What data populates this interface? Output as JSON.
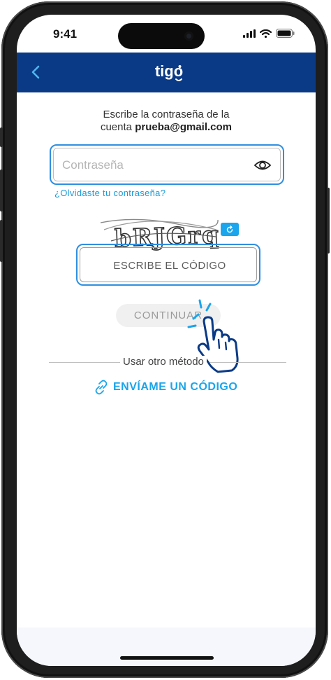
{
  "status_bar": {
    "time": "9:41"
  },
  "header": {
    "brand": "tigo"
  },
  "prompt": {
    "line1": "Escribe la contraseña de la",
    "line2_prefix": "cuenta ",
    "email": "prueba@gmail.com"
  },
  "password": {
    "placeholder": "Contraseña",
    "value": ""
  },
  "forgot_link": "¿Olvidaste tu contraseña?",
  "captcha": {
    "text": "bRJGrq"
  },
  "code_input": {
    "placeholder": "ESCRIBE EL CÓDIGO",
    "value": ""
  },
  "continue_button": "CONTINUAR",
  "alt_method": {
    "label": "Usar otro método",
    "send_code_label": "ENVÍAME UN CÓDIGO"
  },
  "colors": {
    "header_bg": "#0a3a86",
    "accent": "#1aa5ec",
    "focus_border": "#2f8fe0",
    "hand_outline": "#0a3a86"
  },
  "icons": [
    "back-arrow-icon",
    "eye-icon",
    "refresh-icon",
    "link-icon",
    "tap-hand-icon",
    "signal-icon",
    "wifi-icon",
    "battery-icon"
  ]
}
